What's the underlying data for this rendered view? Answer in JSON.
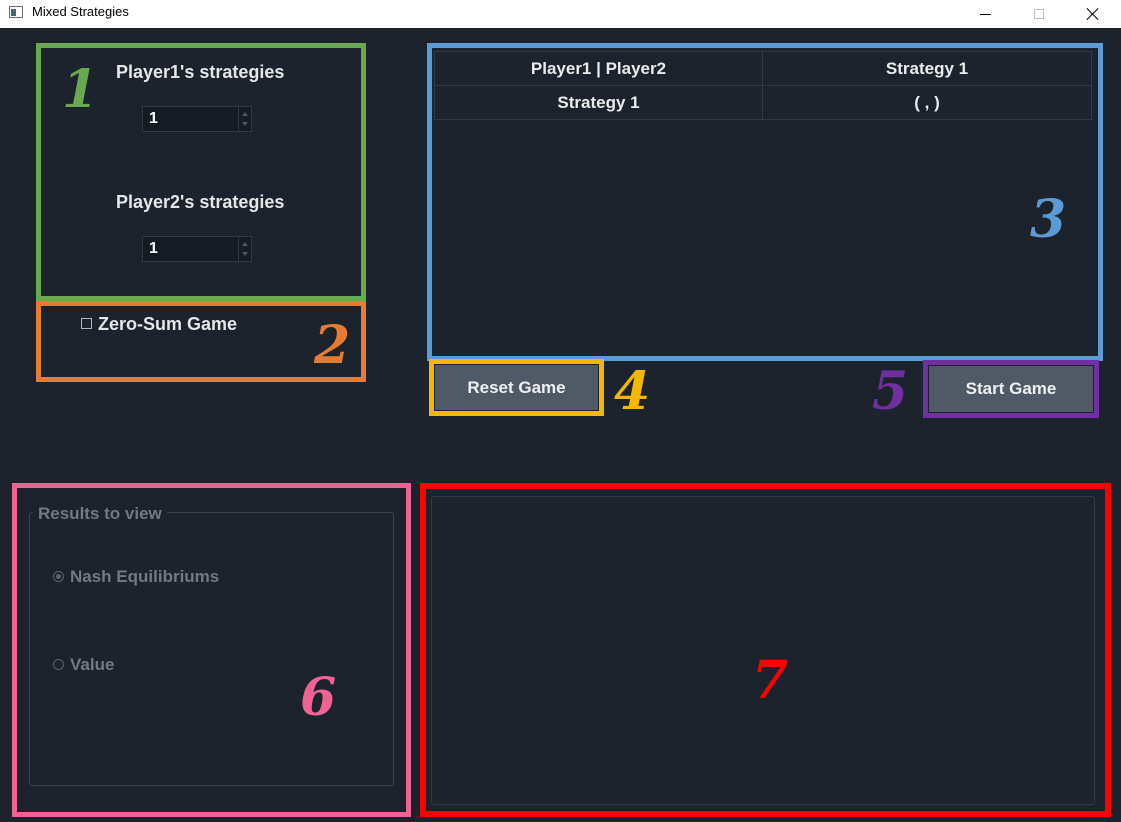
{
  "window": {
    "title": "Mixed Strategies"
  },
  "strategies": {
    "player1_label": "Player1's strategies",
    "player1_value": "1",
    "player2_label": "Player2's strategies",
    "player2_value": "1"
  },
  "options": {
    "zero_sum_label": "Zero-Sum Game",
    "zero_sum_checked": false
  },
  "payoff_table": {
    "header": [
      "Player1 | Player2",
      "Strategy 1"
    ],
    "rows": [
      [
        "Strategy 1",
        "( , )"
      ]
    ]
  },
  "buttons": {
    "reset": "Reset Game",
    "start": "Start Game"
  },
  "results": {
    "group_title": "Results to view",
    "options": [
      {
        "label": "Nash Equilibriums",
        "selected": true
      },
      {
        "label": "Value",
        "selected": false
      }
    ]
  },
  "annotations": [
    {
      "number": "1",
      "color": "#6aa84f"
    },
    {
      "number": "2",
      "color": "#e67c34"
    },
    {
      "number": "3",
      "color": "#5b9bd5"
    },
    {
      "number": "4",
      "color": "#f5b800"
    },
    {
      "number": "5",
      "color": "#7030a0"
    },
    {
      "number": "6",
      "color": "#f06292"
    },
    {
      "number": "7",
      "color": "#ff0000"
    }
  ]
}
